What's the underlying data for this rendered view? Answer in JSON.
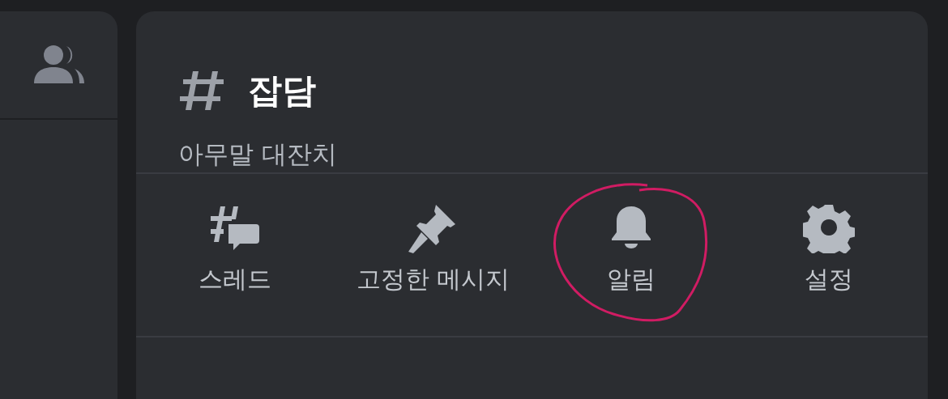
{
  "channel": {
    "name": "잡담",
    "topic": "아무말 대잔치"
  },
  "actions": [
    {
      "kind": "threads",
      "label": "스레드",
      "highlighted": false
    },
    {
      "kind": "pins",
      "label": "고정한 메시지",
      "highlighted": false
    },
    {
      "kind": "notifications",
      "label": "알림",
      "highlighted": true
    },
    {
      "kind": "settings",
      "label": "설정",
      "highlighted": false
    }
  ]
}
